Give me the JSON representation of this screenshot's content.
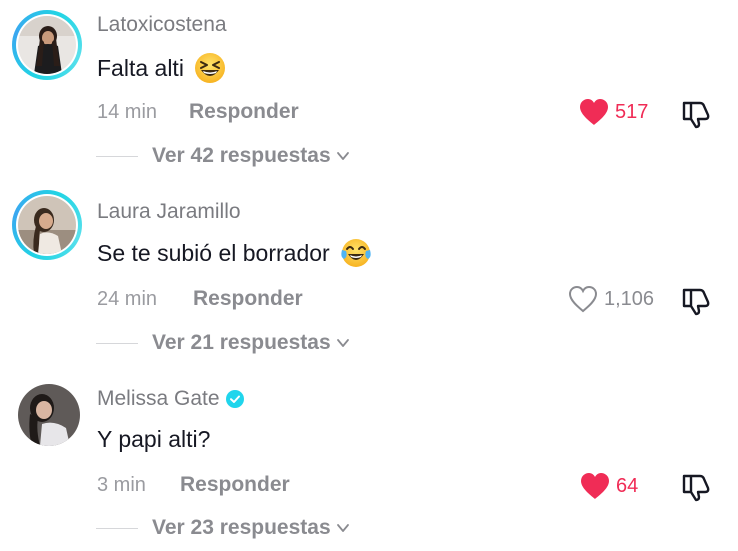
{
  "comments": [
    {
      "username": "Latoxicostena",
      "text": "Falta alti",
      "emoji": "grinning-squinting-face",
      "time": "14 min",
      "reply_label": "Responder",
      "likes": "517",
      "liked": true,
      "view_replies": "Ver 42 respuestas",
      "story_ring": true,
      "verified": false
    },
    {
      "username": "Laura Jaramillo",
      "text": "Se te subió el borrador",
      "emoji": "face-with-tears-of-joy",
      "time": "24 min",
      "reply_label": "Responder",
      "likes": "1,106",
      "liked": false,
      "view_replies": "Ver 21 respuestas",
      "story_ring": true,
      "verified": false
    },
    {
      "username": "Melissa Gate",
      "text": "Y papi alti?",
      "emoji": "",
      "time": "3 min",
      "reply_label": "Responder",
      "likes": "64",
      "liked": true,
      "view_replies": "Ver 23 respuestas",
      "story_ring": false,
      "verified": true
    }
  ],
  "colors": {
    "like_red": "#f02c56",
    "ring_cyan": "#21d4e4",
    "verified_blue": "#20d5ec",
    "text_primary": "#161823",
    "text_secondary": "#8a8b90"
  }
}
